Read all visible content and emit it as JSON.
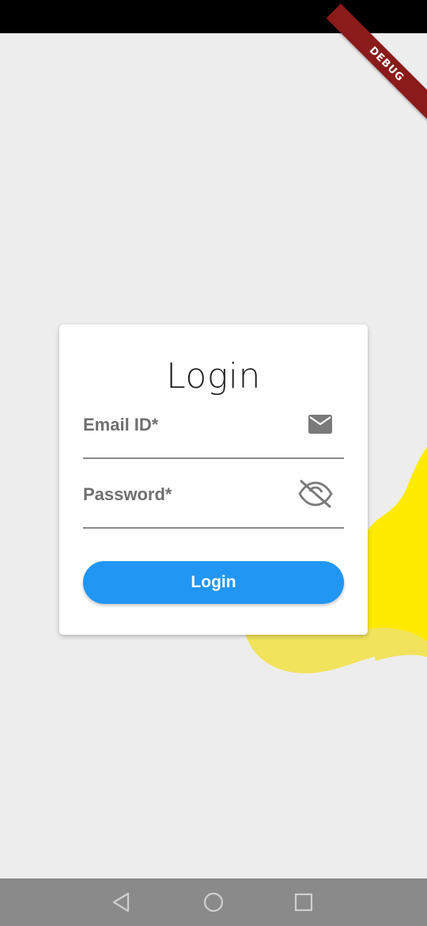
{
  "debug_banner": {
    "label": "DEBUG"
  },
  "login_card": {
    "title": "Login",
    "email": {
      "label": "Email ID*",
      "icon": "mail-icon"
    },
    "password": {
      "label": "Password*",
      "icon": "visibility-off-icon"
    },
    "submit_label": "Login"
  },
  "colors": {
    "accent": "#2196f3",
    "blob_primary": "#ffeb00",
    "blob_secondary": "#f1e35c",
    "background": "#ededed"
  },
  "nav_bar": {
    "buttons": [
      "back-triangle-icon",
      "home-circle-icon",
      "recents-square-icon"
    ]
  }
}
